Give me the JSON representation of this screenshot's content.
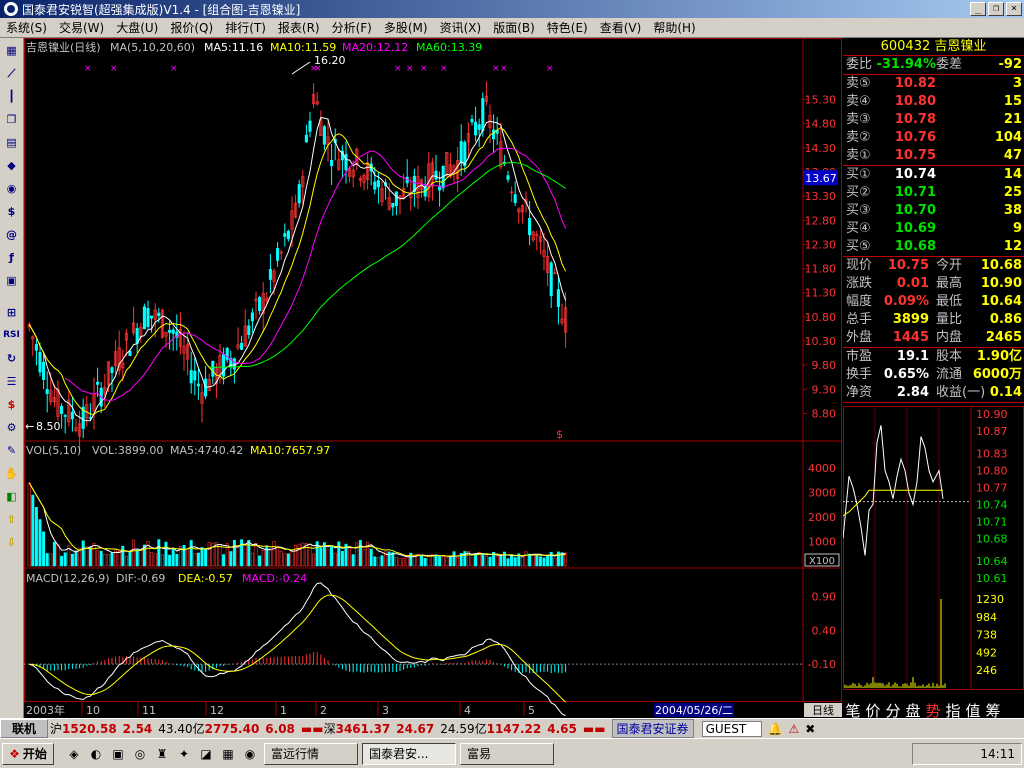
{
  "window": {
    "title": "国泰君安锐智(超强集成版)V1.4 - [组合图-吉恩镍业]",
    "buttons": [
      "_",
      "❐",
      "×"
    ]
  },
  "menu": [
    "系统(S)",
    "交易(W)",
    "大盘(U)",
    "报价(Q)",
    "排行(T)",
    "报表(R)",
    "分析(F)",
    "多股(M)",
    "资讯(X)",
    "版面(B)",
    "特色(E)",
    "查看(V)",
    "帮助(H)"
  ],
  "colors": {
    "up": "#ff3232",
    "down": "#00ffff",
    "ma5": "#ffffff",
    "ma10": "#ffff00",
    "ma20": "#ff00ff",
    "ma60": "#00ff00"
  },
  "price_panel": {
    "title": "吉恩镍业(日线)",
    "ma_label": "MA(5,10,20,60)",
    "ma5": "MA5:11.16",
    "ma10": "MA10:11.59",
    "ma20": "MA20:12.12",
    "ma60": "MA60:13.39",
    "high_label": "16.20",
    "low_label": "8.50",
    "current_tag": "13.67",
    "axis": [
      "15.30",
      "14.80",
      "14.30",
      "13.80",
      "13.30",
      "12.80",
      "12.30",
      "11.80",
      "11.30",
      "10.80",
      "10.30",
      "9.80",
      "9.30",
      "8.80"
    ]
  },
  "vol_panel": {
    "title": "VOL(5,10)",
    "vol": "VOL:3899.00",
    "ma5": "MA5:4740.42",
    "ma10": "MA10:7657.97",
    "axis": [
      "4000",
      "3000",
      "2000",
      "1000"
    ],
    "unit": "X100"
  },
  "macd_panel": {
    "title": "MACD(12,26,9)",
    "dif": "DIF:-0.69",
    "dea": "DEA:-0.57",
    "macd": "MACD:-0.24",
    "axis": [
      "0.90",
      "0.40",
      "-0.10"
    ]
  },
  "x_axis": {
    "year": "2003年",
    "months": [
      "10",
      "11",
      "12",
      "1",
      "2",
      "3",
      "4",
      "5"
    ],
    "date": "2004/05/26/二",
    "period": "日线"
  },
  "quote": {
    "header": "600432 吉恩镍业",
    "weibi_label": "委比",
    "weibi": "-31.94%",
    "weicha_label": "委差",
    "weicha": "-92",
    "sells": [
      {
        "label": "卖⑤",
        "price": "10.82",
        "vol": "3"
      },
      {
        "label": "卖④",
        "price": "10.80",
        "vol": "15"
      },
      {
        "label": "卖③",
        "price": "10.78",
        "vol": "21"
      },
      {
        "label": "卖②",
        "price": "10.76",
        "vol": "104"
      },
      {
        "label": "卖①",
        "price": "10.75",
        "vol": "47"
      }
    ],
    "buys": [
      {
        "label": "买①",
        "price": "10.74",
        "vol": "14"
      },
      {
        "label": "买②",
        "price": "10.71",
        "vol": "25"
      },
      {
        "label": "买③",
        "price": "10.70",
        "vol": "38"
      },
      {
        "label": "买④",
        "price": "10.69",
        "vol": "9"
      },
      {
        "label": "买⑤",
        "price": "10.68",
        "vol": "12"
      }
    ],
    "stats": [
      {
        "l1": "现价",
        "v1": "10.75",
        "c1": "red",
        "l2": "今开",
        "v2": "10.68",
        "c2": "green"
      },
      {
        "l1": "涨跌",
        "v1": "0.01",
        "c1": "red",
        "l2": "最高",
        "v2": "10.90",
        "c2": "red"
      },
      {
        "l1": "幅度",
        "v1": "0.09%",
        "c1": "red",
        "l2": "最低",
        "v2": "10.64",
        "c2": "green"
      },
      {
        "l1": "总手",
        "v1": "3899",
        "c1": "yellow",
        "l2": "量比",
        "v2": "0.86",
        "c2": "white"
      },
      {
        "l1": "外盘",
        "v1": "1445",
        "c1": "red",
        "l2": "内盘",
        "v2": "2465",
        "c2": "green"
      }
    ],
    "stats2": [
      {
        "l1": "市盈",
        "v1": "19.1",
        "l2": "股本",
        "v2": "1.90亿"
      },
      {
        "l1": "换手",
        "v1": "0.65%",
        "l2": "流通",
        "v2": "6000万"
      },
      {
        "l1": "净资",
        "v1": "2.84",
        "l2": "收益(一)",
        "v2": "0.14"
      }
    ]
  },
  "mini_chart": {
    "price_axis": [
      "10.90",
      "10.87",
      "10.83",
      "10.80",
      "10.77",
      "10.74",
      "10.71",
      "10.68",
      "10.64",
      "10.61"
    ],
    "vol_axis": [
      "1230",
      "984",
      "738",
      "492",
      "246"
    ]
  },
  "bottom_tabs": [
    "笔",
    "价",
    "分",
    "盘",
    "势",
    "指",
    "值",
    "筹"
  ],
  "statusbar": {
    "conn": "联机",
    "sh_label": "沪",
    "sh_index": "1520.58",
    "sh_change": "2.54",
    "sh_amount": "43.40亿",
    "sh_vol": "2775.40",
    "sh_extra": "6.08",
    "sz_label": "深",
    "sz_index": "3461.37",
    "sz_change": "24.67",
    "sz_amount": "24.59亿",
    "sz_vol": "1147.22",
    "sz_extra": "4.65",
    "broker": "国泰君安证券",
    "user": "GUEST"
  },
  "taskbar": {
    "start": "开始",
    "tasks": [
      "富远行情",
      "国泰君安...",
      "富易"
    ],
    "clock": "14:11"
  }
}
